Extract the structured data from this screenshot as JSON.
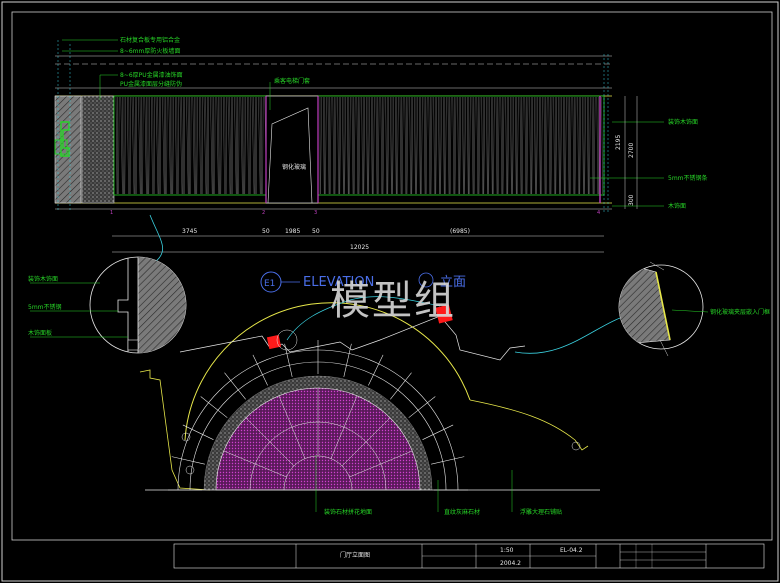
{
  "watermark": "模型组",
  "top_labels": [
    "石材复合板专用铝合金",
    "8~6mm厚防火板墙面",
    "8~6厚PU金属漆油饰面",
    "PU金属漆面层分缝防伪"
  ],
  "door_label": "乘客电梯门套",
  "panel_label": "钢化玻璃",
  "right_labels": [
    "装饰木饰面",
    "5mm不锈钢条",
    "木饰面"
  ],
  "height_dims": [
    "2195",
    "2700",
    "300"
  ],
  "width_dims": [
    "3745",
    "50",
    "1985",
    "50",
    "(6985)"
  ],
  "total_dim": "12025",
  "elevation_title": "ELEVATION",
  "elevation_title_suffix": "立面",
  "elevation_marker": "E1",
  "left_detail_labels": [
    "装饰木饰面",
    "5mm不锈钢",
    "木饰面板"
  ],
  "right_detail_label": "钢化玻璃夹层嵌入门框",
  "bottom_labels": [
    "装饰石材拼花地面",
    "直纹灰麻石材",
    "浮雕大理石铺贴"
  ],
  "title_block": {
    "project": "门厅立面图",
    "scale": "1:50",
    "sheet": "EL-04.2",
    "date": "2004.2"
  },
  "colors": {
    "background": "#000000",
    "green": "#27d627",
    "yellow": "#e8e84a",
    "cyan": "#3ad1e0",
    "magenta": "#c040c0",
    "blue": "#4a6ee8",
    "red": "#ff1a1a"
  }
}
